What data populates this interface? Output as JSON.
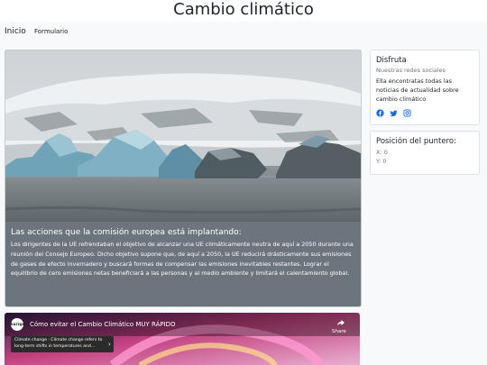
{
  "site": {
    "title": "Cambio climático"
  },
  "nav": {
    "home": "Inicio",
    "form": "Formulario"
  },
  "main_card": {
    "image_alt": "Glaciar e icebergs",
    "title": "Las acciones que la comisión europea está implantando:",
    "text": "Los dirigentes de la UE refrendaban el objetivo de alcanzar una UE climáticamente neutra de aquí a 2050 durante una reunión del Consejo Europeo. Dicho objetivo supone que, de aquí a 2050, la UE reducirá drásticamente sus emisiones de gases de efecto invernadero y buscará formas de compensar las emisiones inevitables restantes. Lograr el equilibrio de cero emisiones netas beneficiará a las personas y al medio ambiente y limitará el calentamiento global."
  },
  "enjoy_card": {
    "title": "Disfruta",
    "subtitle": "Nuestras redes sociales",
    "text": "Ella encontratas todas las noticias de actualidad sobre cambio climático",
    "icons": [
      "facebook-icon",
      "twitter-icon",
      "instagram-icon"
    ],
    "icon_color": "#0d6efd"
  },
  "mouse_card": {
    "title": "Posición del puntero:",
    "x": "X: 0",
    "y": "Y: 0"
  },
  "video": {
    "title": "Cómo evitar el Cambio Climático MUY RÁPIDO",
    "share": "Share",
    "info": "Climate change · Climate change refers to long-term shifts in temperatures and...",
    "channel_logo": "kurzgesagt"
  }
}
